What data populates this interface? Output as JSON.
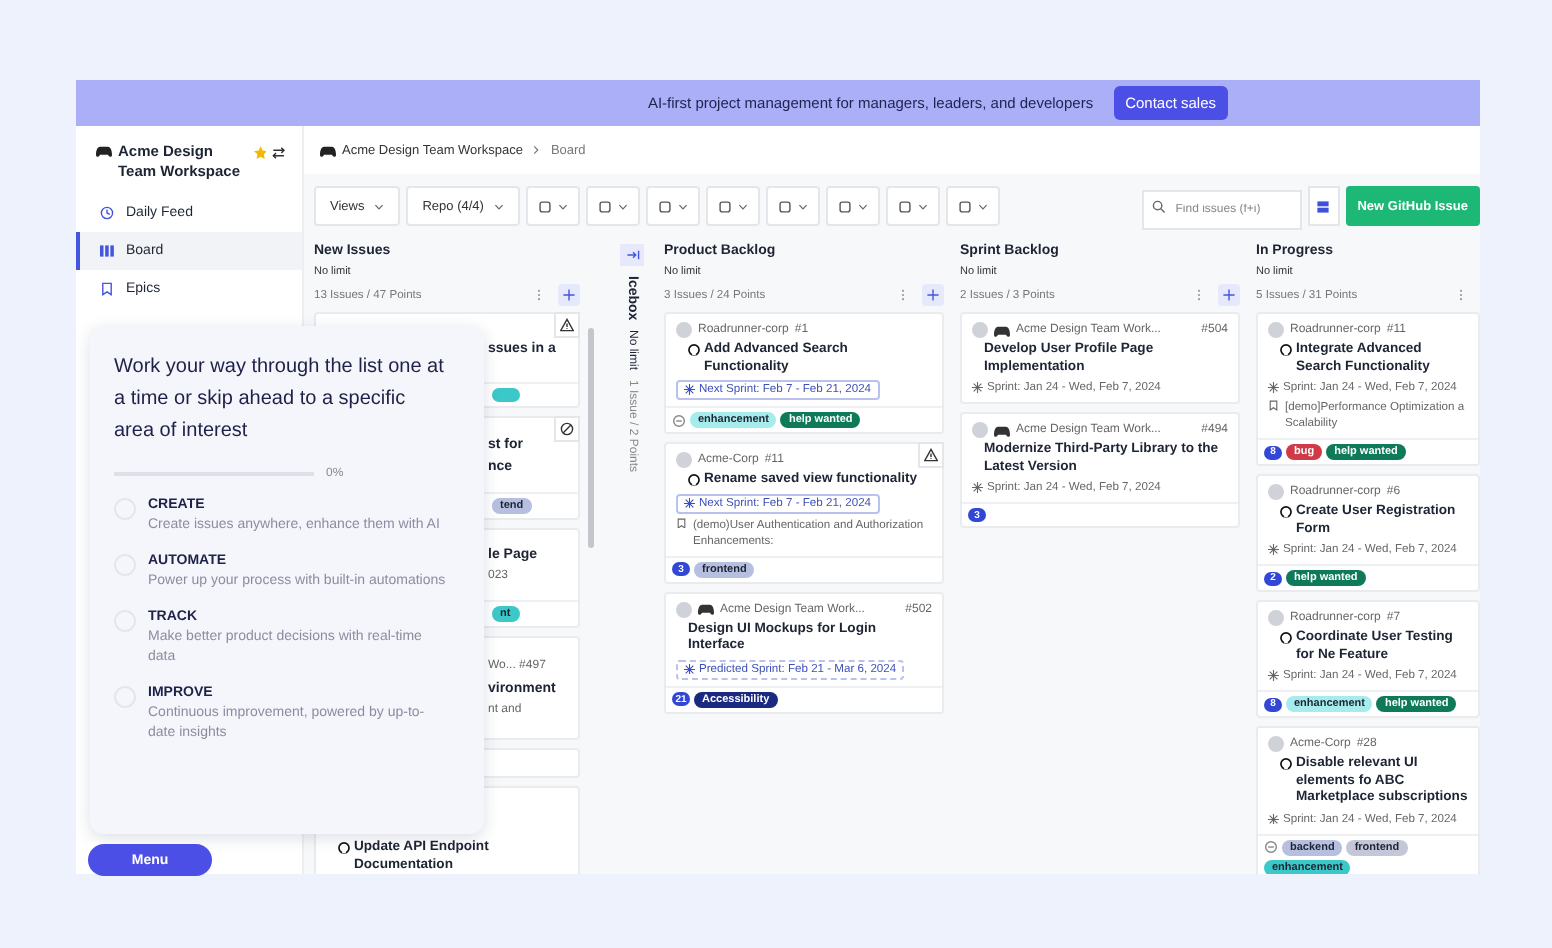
{
  "banner": {
    "text": "AI-first project management for managers, leaders, and developers",
    "button": "Contact sales"
  },
  "sidebar": {
    "workspace": "Acme Design Team Workspace",
    "favorite": true,
    "items": [
      {
        "label": "Daily Feed",
        "selected": false
      },
      {
        "label": "Board",
        "selected": true
      },
      {
        "label": "Epics",
        "selected": false
      }
    ]
  },
  "breadcrumb": {
    "workspace": "Acme Design Team Workspace",
    "page": "Board"
  },
  "toolbar": {
    "filters": [
      {
        "label": "Views"
      },
      {
        "label": "Repo (4/4)"
      }
    ],
    "search": {
      "placeholder": "Find issues (f+i)"
    },
    "new_issue_button": "New GitHub Issue"
  },
  "columns": [
    {
      "kind": "list",
      "title": "New Issues",
      "limit": "No limit",
      "summary": "13 Issues / 47 Points",
      "cards": [
        {
          "kind": "partial",
          "warning": true,
          "lines": [
            {
              "kind": "title",
              "text": "ssues in a"
            }
          ],
          "labels": [
            {
              "color": "#3cc8c8"
            }
          ]
        },
        {
          "kind": "partial",
          "blocked": true,
          "lines": [
            {
              "kind": "title",
              "text": "st for"
            },
            {
              "kind": "title",
              "text": "nce"
            }
          ],
          "labels": [
            {
              "text": "tend",
              "color": "#b7bfe0"
            }
          ]
        },
        {
          "kind": "partial",
          "lines": [
            {
              "kind": "title",
              "text": "le Page"
            },
            {
              "kind": "meta",
              "text": "023"
            }
          ],
          "labels": [
            {
              "text": "nt",
              "color": "#3cc8c8"
            }
          ]
        },
        {
          "kind": "partial",
          "lines": [
            {
              "kind": "meta",
              "text": "Wo...  #497"
            },
            {
              "kind": "title",
              "text": "vironment"
            },
            {
              "kind": "meta",
              "text": "nt and"
            }
          ]
        },
        {
          "kind": "partial"
        },
        {
          "kind": "full",
          "github": true,
          "title": "Update API Endpoint Documentation"
        }
      ]
    },
    {
      "kind": "collapsed",
      "title": "Icebox",
      "limit": "No limit",
      "summary": "1 Issue / 2 Points"
    },
    {
      "kind": "list",
      "title": "Product Backlog",
      "limit": "No limit",
      "summary": "3 Issues / 24 Points",
      "cards": [
        {
          "kind": "full",
          "repo": "Roadrunner-corp",
          "github": true,
          "number": "#1",
          "title": "Add Advanced Search Functionality",
          "sprint": {
            "kind": "next",
            "text": "Next Sprint: Feb 7 - Feb 21, 2024"
          },
          "labels": [
            {
              "text": "enhancement",
              "color": "#a6ecec"
            },
            {
              "text": "help wanted",
              "color": "#0e7a5a"
            }
          ]
        },
        {
          "kind": "full",
          "repo": "Acme-Corp",
          "github": true,
          "number": "#11",
          "title": "Rename saved view functionality",
          "warning": true,
          "sprint": {
            "kind": "next",
            "text": "Next Sprint: Feb 7 - Feb 21, 2024"
          },
          "epic": "(demo)User Authentication and Authorization Enhancements:",
          "points": "3",
          "labels": [
            {
              "text": "frontend",
              "color": "#b7bfe0"
            }
          ]
        },
        {
          "kind": "full",
          "repo": "Acme Design Team Work...",
          "github": false,
          "number": "#502",
          "title": "Design UI Mockups for Login Interface",
          "sprint": {
            "kind": "predicted",
            "text": "Predicted Sprint: Feb 21 - Mar 6, 2024"
          },
          "points": "21",
          "labels": [
            {
              "text": "Accessibility",
              "color": "#1b2a80"
            }
          ]
        }
      ]
    },
    {
      "kind": "list",
      "title": "Sprint Backlog",
      "limit": "No limit",
      "summary": "2 Issues / 3 Points",
      "cards": [
        {
          "kind": "full",
          "repo": "Acme Design Team Work...",
          "github": false,
          "number": "#504",
          "title": "Develop User Profile Page Implementation",
          "sprint": {
            "kind": "current",
            "text": "Sprint: Jan 24 - Wed, Feb 7, 2024"
          }
        },
        {
          "kind": "full",
          "repo": "Acme Design Team Work...",
          "github": false,
          "number": "#494",
          "title": "Modernize Third-Party Library to the Latest Version",
          "sprint": {
            "kind": "current",
            "text": "Sprint: Jan 24 - Wed, Feb 7, 2024"
          },
          "points": "3"
        }
      ]
    },
    {
      "kind": "list",
      "title": "In Progress",
      "limit": "No limit",
      "summary": "5 Issues / 31 Points",
      "cards": [
        {
          "kind": "full",
          "repo": "Roadrunner-corp",
          "github": true,
          "number": "#11",
          "title": "Integrate Advanced Search Functionality",
          "sprint": {
            "kind": "current",
            "text": "Sprint: Jan 24 - Wed, Feb 7, 2024"
          },
          "epic": "[demo]Performance Optimization a Scalability",
          "points": "8",
          "labels": [
            {
              "text": "bug",
              "color": "#d03a48"
            },
            {
              "text": "help wanted",
              "color": "#0e7a5a"
            }
          ]
        },
        {
          "kind": "full",
          "repo": "Roadrunner-corp",
          "github": true,
          "number": "#6",
          "title": "Create User Registration Form",
          "sprint": {
            "kind": "current",
            "text": "Sprint: Jan 24 - Wed, Feb 7, 2024"
          },
          "points": "2",
          "labels": [
            {
              "text": "help wanted",
              "color": "#0e7a5a"
            }
          ]
        },
        {
          "kind": "full",
          "repo": "Roadrunner-corp",
          "github": true,
          "number": "#7",
          "title": "Coordinate User Testing for Ne Feature",
          "sprint": {
            "kind": "current",
            "text": "Sprint: Jan 24 - Wed, Feb 7, 2024"
          },
          "points": "8",
          "labels": [
            {
              "text": "enhancement",
              "color": "#a6ecec"
            },
            {
              "text": "help wanted",
              "color": "#0e7a5a"
            }
          ]
        },
        {
          "kind": "full",
          "repo": "Acme-Corp",
          "github": true,
          "number": "#28",
          "title": "Disable relevant UI elements fo ABC Marketplace subscriptions",
          "sprint": {
            "kind": "current",
            "text": "Sprint: Jan 24 - Wed, Feb 7, 2024"
          },
          "labels": [
            {
              "text": "backend",
              "color": "#b7bfe0"
            },
            {
              "text": "frontend",
              "color": "#c3c7d8"
            },
            {
              "text": "enhancement",
              "color": "#3cc8c8"
            }
          ]
        }
      ]
    }
  ],
  "guide": {
    "title": "Work your way through the list one at a time or skip ahead to a specific area of interest",
    "progress": {
      "level": 0,
      "reading": "0%"
    },
    "steps": [
      {
        "title": "CREATE",
        "description": "Create issues anywhere, enhance them with AI",
        "checked": false
      },
      {
        "title": "AUTOMATE",
        "description": "Power up your process with built-in automations",
        "checked": false
      },
      {
        "title": "TRACK",
        "description": "Make better product decisions with real-time data",
        "checked": false
      },
      {
        "title": "IMPROVE",
        "description": "Continuous improvement, powered by up-to-date insights",
        "checked": false
      }
    ]
  },
  "menu_button": "Menu"
}
